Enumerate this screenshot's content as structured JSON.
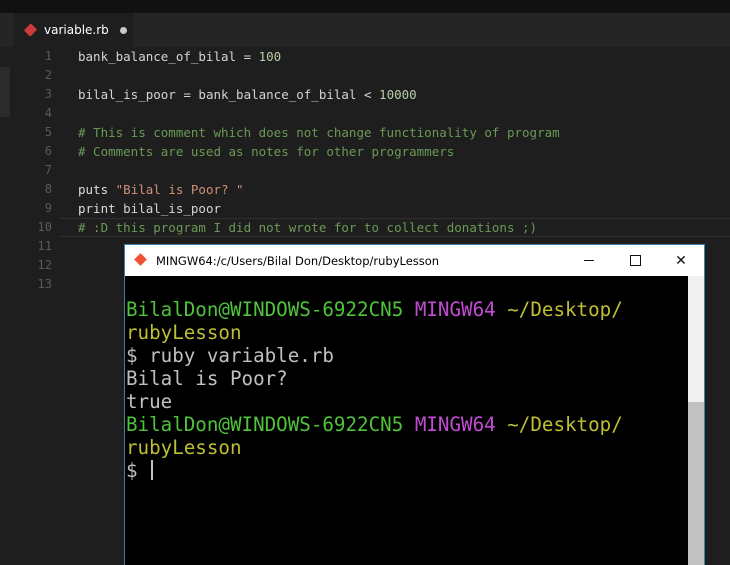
{
  "editor": {
    "tab": {
      "filename": "variable.rb",
      "icon": "ruby-icon",
      "modified": true
    },
    "line_numbers": [
      "1",
      "2",
      "3",
      "4",
      "5",
      "6",
      "7",
      "8",
      "9",
      "10",
      "11",
      "12",
      "13"
    ],
    "lines": [
      [
        {
          "t": "bank_balance_of_bilal",
          "c": "var"
        },
        {
          "t": " = ",
          "c": "op"
        },
        {
          "t": "100",
          "c": "num"
        }
      ],
      [],
      [
        {
          "t": "bilal_is_poor",
          "c": "var"
        },
        {
          "t": " = ",
          "c": "op"
        },
        {
          "t": "bank_balance_of_bilal",
          "c": "var"
        },
        {
          "t": " < ",
          "c": "op"
        },
        {
          "t": "10000",
          "c": "num"
        }
      ],
      [],
      [
        {
          "t": "# This is comment which does not change functionality of program",
          "c": "com"
        }
      ],
      [
        {
          "t": "# Comments are used as notes for other programmers",
          "c": "com"
        }
      ],
      [],
      [
        {
          "t": "puts ",
          "c": "kw"
        },
        {
          "t": "\"Bilal is Poor? \"",
          "c": "str"
        }
      ],
      [
        {
          "t": "print ",
          "c": "kw"
        },
        {
          "t": "bilal_is_poor",
          "c": "var"
        }
      ],
      [
        {
          "t": "# :D this program I did not wrote for to collect donations ;)",
          "c": "com"
        }
      ],
      [],
      [],
      []
    ]
  },
  "terminal": {
    "title": "MINGW64:/c/Users/Bilal Don/Desktop/rubyLesson",
    "icon": "git-bash-icon",
    "controls": {
      "minimize": "minimize",
      "maximize": "maximize",
      "close": "✕"
    },
    "lines": [
      [
        {
          "t": "BilalDon@WINDOWS-6922CN5",
          "c": "green"
        },
        {
          "t": " ",
          "c": "wht"
        },
        {
          "t": "MINGW64",
          "c": "mag"
        },
        {
          "t": " ",
          "c": "wht"
        },
        {
          "t": "~/Desktop/",
          "c": "yel"
        }
      ],
      [
        {
          "t": "rubyLesson",
          "c": "yel"
        }
      ],
      [
        {
          "t": "$ ruby variable.rb",
          "c": "wht"
        }
      ],
      [
        {
          "t": "Bilal is Poor?",
          "c": "wht"
        }
      ],
      [
        {
          "t": "true",
          "c": "wht"
        }
      ],
      [
        {
          "t": "BilalDon@WINDOWS-6922CN5",
          "c": "green"
        },
        {
          "t": " ",
          "c": "wht"
        },
        {
          "t": "MINGW64",
          "c": "mag"
        },
        {
          "t": " ",
          "c": "wht"
        },
        {
          "t": "~/Desktop/",
          "c": "yel"
        }
      ],
      [
        {
          "t": "rubyLesson",
          "c": "yel"
        }
      ],
      [
        {
          "t": "$ ",
          "c": "wht"
        }
      ]
    ],
    "colors": {
      "green": "#4fc43a",
      "magenta": "#c24bd3",
      "yellow": "#bfbf33",
      "text": "#c0c0c0",
      "background": "#000000"
    }
  }
}
